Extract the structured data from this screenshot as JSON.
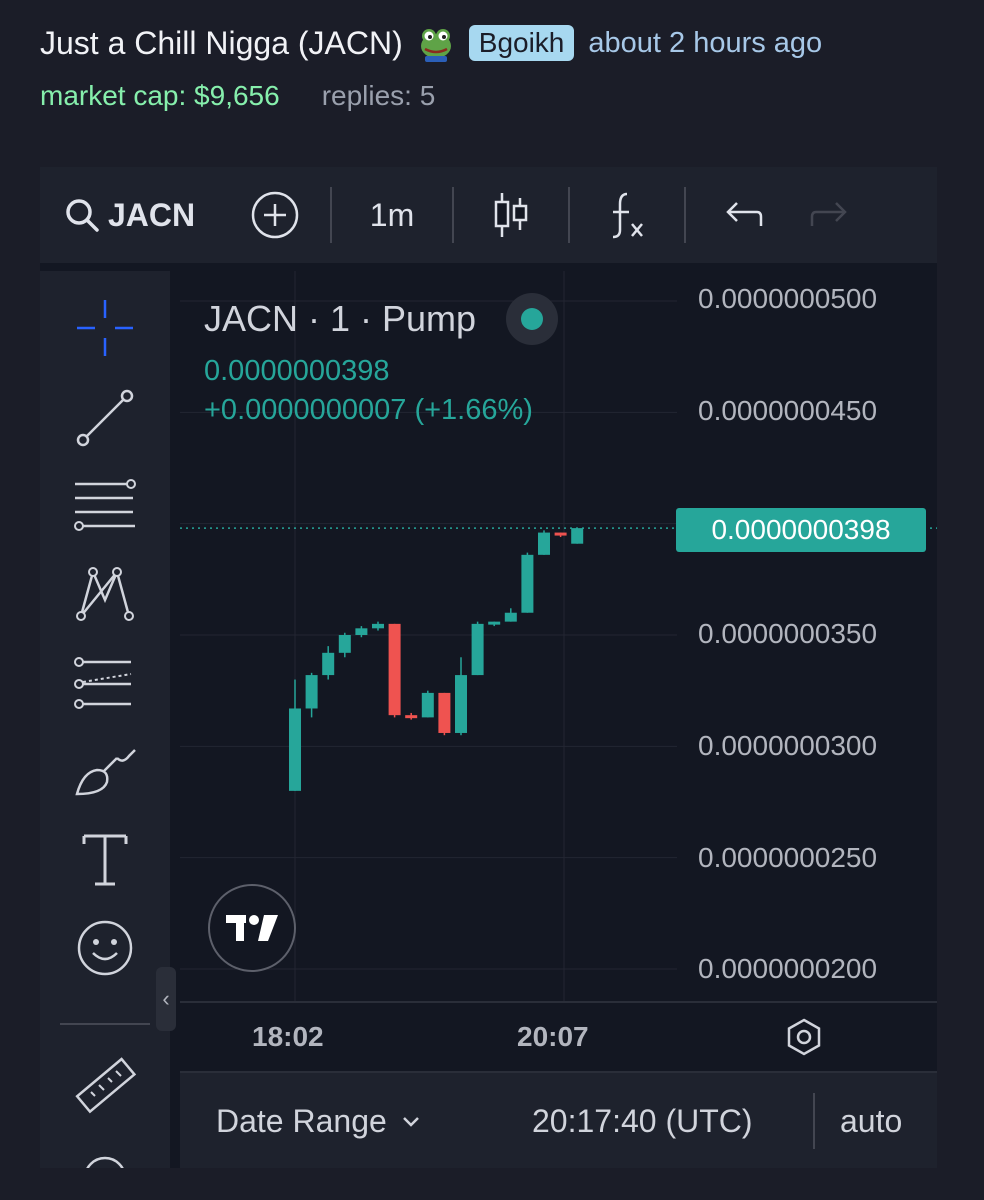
{
  "post": {
    "title": "Just a Chill Nigga (JACN)",
    "username": "Bgoikh",
    "time_ago": "about 2 hours ago",
    "market_cap": "market cap: $9,656",
    "replies": "replies: 5"
  },
  "toolbar": {
    "symbol": "JACN",
    "interval": "1m",
    "icons": [
      "search-icon",
      "add-symbol-icon",
      "candles-icon",
      "indicators-icon",
      "undo-icon",
      "redo-icon"
    ]
  },
  "left_tools": [
    "crosshair-icon",
    "trend-line-icon",
    "fib-retracement-icon",
    "pattern-icon",
    "prediction-icon",
    "brush-icon",
    "text-icon",
    "emoji-icon",
    "ruler-icon"
  ],
  "legend": {
    "title": "JACN · 1 · Pump",
    "price": "0.0000000398",
    "change": "+0.0000000007 (+1.66%)"
  },
  "bottom_bar": {
    "date_range": "Date Range",
    "utc_time": "20:17:40 (UTC)",
    "auto": "auto"
  },
  "colors": {
    "up": "#26a69a",
    "down": "#ef5350",
    "background": "#131722",
    "accent_link": "#a7c8e8"
  },
  "chart_data": {
    "type": "candlestick",
    "title": "JACN · 1 · Pump",
    "y_ticks": [
      "0.0000000500",
      "0.0000000450",
      "0.0000000398",
      "0.0000000350",
      "0.0000000300",
      "0.0000000250",
      "0.0000000200"
    ],
    "x_ticks": [
      "18:02",
      "20:07"
    ],
    "ylim": [
      2e-08,
      5e-08
    ],
    "current_price": 3.98e-08,
    "last_price_label": "0.0000000398",
    "candles": [
      {
        "o": 2.8e-08,
        "h": 3.3e-08,
        "l": 2.8e-08,
        "c": 3.17e-08
      },
      {
        "o": 3.17e-08,
        "h": 3.33e-08,
        "l": 3.13e-08,
        "c": 3.32e-08
      },
      {
        "o": 3.32e-08,
        "h": 3.45e-08,
        "l": 3.3e-08,
        "c": 3.42e-08
      },
      {
        "o": 3.42e-08,
        "h": 3.51e-08,
        "l": 3.4e-08,
        "c": 3.5e-08
      },
      {
        "o": 3.5e-08,
        "h": 3.54e-08,
        "l": 3.49e-08,
        "c": 3.53e-08
      },
      {
        "o": 3.53e-08,
        "h": 3.56e-08,
        "l": 3.52e-08,
        "c": 3.55e-08
      },
      {
        "o": 3.55e-08,
        "h": 3.55e-08,
        "l": 3.13e-08,
        "c": 3.14e-08
      },
      {
        "o": 3.14e-08,
        "h": 3.15e-08,
        "l": 3.12e-08,
        "c": 3.13e-08
      },
      {
        "o": 3.13e-08,
        "h": 3.25e-08,
        "l": 3.13e-08,
        "c": 3.24e-08
      },
      {
        "o": 3.24e-08,
        "h": 3.24e-08,
        "l": 3.05e-08,
        "c": 3.06e-08
      },
      {
        "o": 3.06e-08,
        "h": 3.4e-08,
        "l": 3.05e-08,
        "c": 3.32e-08
      },
      {
        "o": 3.32e-08,
        "h": 3.56e-08,
        "l": 3.32e-08,
        "c": 3.55e-08
      },
      {
        "o": 3.55e-08,
        "h": 3.56e-08,
        "l": 3.54e-08,
        "c": 3.56e-08
      },
      {
        "o": 3.56e-08,
        "h": 3.62e-08,
        "l": 3.56e-08,
        "c": 3.6e-08
      },
      {
        "o": 3.6e-08,
        "h": 3.87e-08,
        "l": 3.6e-08,
        "c": 3.86e-08
      },
      {
        "o": 3.86e-08,
        "h": 3.97e-08,
        "l": 3.86e-08,
        "c": 3.96e-08
      },
      {
        "o": 3.96e-08,
        "h": 3.96e-08,
        "l": 3.94e-08,
        "c": 3.95e-08
      },
      {
        "o": 3.91e-08,
        "h": 3.98e-08,
        "l": 3.91e-08,
        "c": 3.98e-08
      }
    ]
  }
}
